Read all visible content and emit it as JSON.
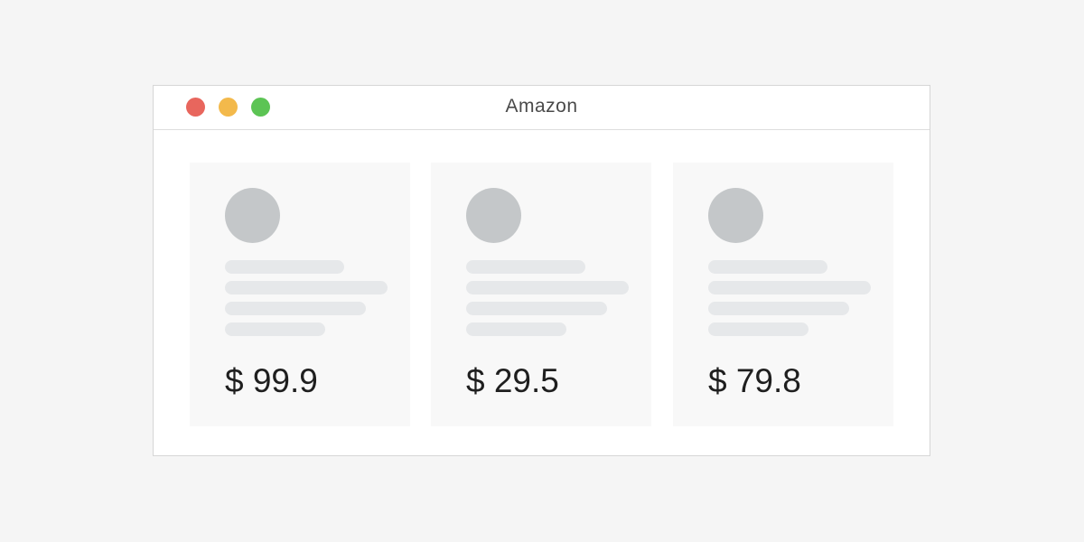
{
  "window": {
    "title": "Amazon",
    "controls": {
      "close_color": "#e8665d",
      "minimize_color": "#f3b94b",
      "maximize_color": "#5cc454"
    }
  },
  "placeholder_colors": {
    "avatar": "#c4c7c9",
    "text_line": "#e6e8ea"
  },
  "products": [
    {
      "price": "$ 99.9"
    },
    {
      "price": "$ 29.5"
    },
    {
      "price": "$ 79.8"
    }
  ]
}
